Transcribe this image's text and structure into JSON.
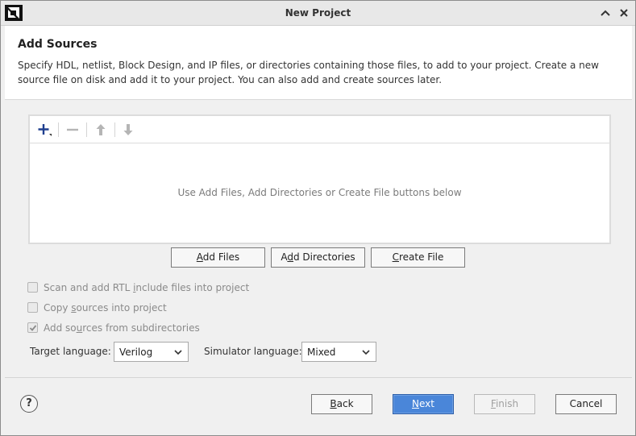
{
  "window": {
    "title": "New Project",
    "controls": {
      "collapse_icon": "chevron-up-icon",
      "close_icon": "close-icon"
    }
  },
  "header": {
    "title": "Add Sources",
    "description": "Specify HDL, netlist, Block Design, and IP files, or directories containing those files, to add to your project. Create a new source file on disk and add it to your project. You can also add and create sources later."
  },
  "files_panel": {
    "toolbar": [
      {
        "icon": "add-icon",
        "enabled": true
      },
      {
        "icon": "remove-icon",
        "enabled": false
      },
      {
        "icon": "move-up-icon",
        "enabled": false
      },
      {
        "icon": "move-down-icon",
        "enabled": false
      }
    ],
    "empty_message": "Use Add Files, Add Directories or Create File buttons below"
  },
  "buttons": {
    "add_files": "Add Files",
    "add_directories": "Add Directories",
    "create_file": "Create File"
  },
  "options": [
    {
      "label": "Scan and add RTL include files into project",
      "checked": false,
      "enabled": false
    },
    {
      "label": "Copy sources into project",
      "checked": false,
      "enabled": false
    },
    {
      "label": "Add sources from subdirectories",
      "checked": true,
      "enabled": false
    }
  ],
  "language": {
    "target_label": "Target language:",
    "target_value": "Verilog",
    "simulator_label": "Simulator language:",
    "simulator_value": "Mixed"
  },
  "footer": {
    "help": "?",
    "back": "Back",
    "next": "Next",
    "finish": "Finish",
    "cancel": "Cancel"
  },
  "colors": {
    "accent": "#4a86d9",
    "panel_bg": "#ffffff",
    "dialog_bg": "#f0f0f0",
    "disabled_text": "#a0a0a0"
  }
}
